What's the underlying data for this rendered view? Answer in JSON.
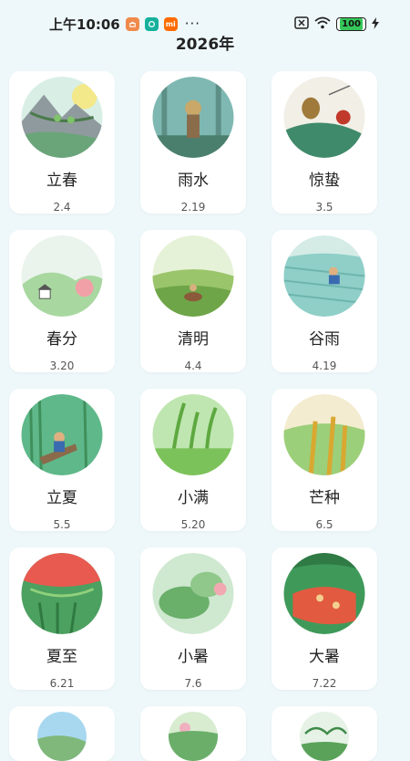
{
  "status_bar": {
    "time": "上午10:06",
    "app_icons": [
      "taobao-icon",
      "app-green-icon",
      "mi-icon"
    ],
    "mi_label": "mi",
    "more": "···",
    "battery": "100"
  },
  "page": {
    "year_title": "2026年"
  },
  "terms": [
    {
      "name": "立春",
      "date": "2.4"
    },
    {
      "name": "雨水",
      "date": "2.19"
    },
    {
      "name": "惊蛰",
      "date": "3.5"
    },
    {
      "name": "春分",
      "date": "3.20"
    },
    {
      "name": "清明",
      "date": "4.4"
    },
    {
      "name": "谷雨",
      "date": "4.19"
    },
    {
      "name": "立夏",
      "date": "5.5"
    },
    {
      "name": "小满",
      "date": "5.20"
    },
    {
      "name": "芒种",
      "date": "6.5"
    },
    {
      "name": "夏至",
      "date": "6.21"
    },
    {
      "name": "小暑",
      "date": "7.6"
    },
    {
      "name": "大暑",
      "date": "7.22"
    }
  ],
  "colors": {
    "background": "#eef8fa",
    "card": "#ffffff",
    "accent_green": "#5fbf6a"
  }
}
